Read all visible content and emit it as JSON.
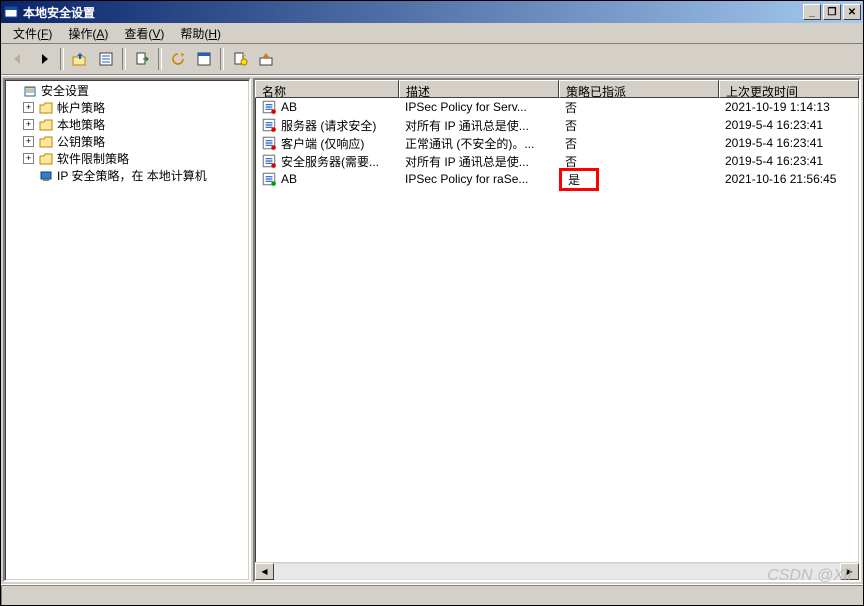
{
  "window": {
    "title": "本地安全设置"
  },
  "menu": {
    "file": "文件(F)",
    "action": "操作(A)",
    "view": "查看(V)",
    "help": "帮助(H)"
  },
  "tree": {
    "root": "安全设置",
    "items": [
      {
        "label": "帐户策略"
      },
      {
        "label": "本地策略"
      },
      {
        "label": "公钥策略"
      },
      {
        "label": "软件限制策略"
      },
      {
        "label": "IP 安全策略，在 本地计算机"
      }
    ]
  },
  "list": {
    "columns": {
      "name": "名称",
      "description": "描述",
      "assigned": "策略已指派",
      "modified": "上次更改时间"
    },
    "rows": [
      {
        "name": "AB",
        "description": "IPSec Policy for Serv...",
        "assigned": "否",
        "modified": "2021-10-19 1:14:13",
        "highlight": false
      },
      {
        "name": "服务器 (请求安全)",
        "description": "对所有 IP 通讯总是使...",
        "assigned": "否",
        "modified": "2019-5-4 16:23:41",
        "highlight": false
      },
      {
        "name": "客户端 (仅响应)",
        "description": "正常通讯 (不安全的)。...",
        "assigned": "否",
        "modified": "2019-5-4 16:23:41",
        "highlight": false
      },
      {
        "name": "安全服务器(需要...",
        "description": "对所有 IP 通讯总是使...",
        "assigned": "否",
        "modified": "2019-5-4 16:23:41",
        "highlight": false
      },
      {
        "name": "AB",
        "description": "IPSec Policy for raSe...",
        "assigned": "是",
        "modified": "2021-10-16 21:56:45",
        "highlight": true
      }
    ]
  },
  "statusbar": {
    "text": ""
  },
  "watermark": "CSDN @Xll"
}
